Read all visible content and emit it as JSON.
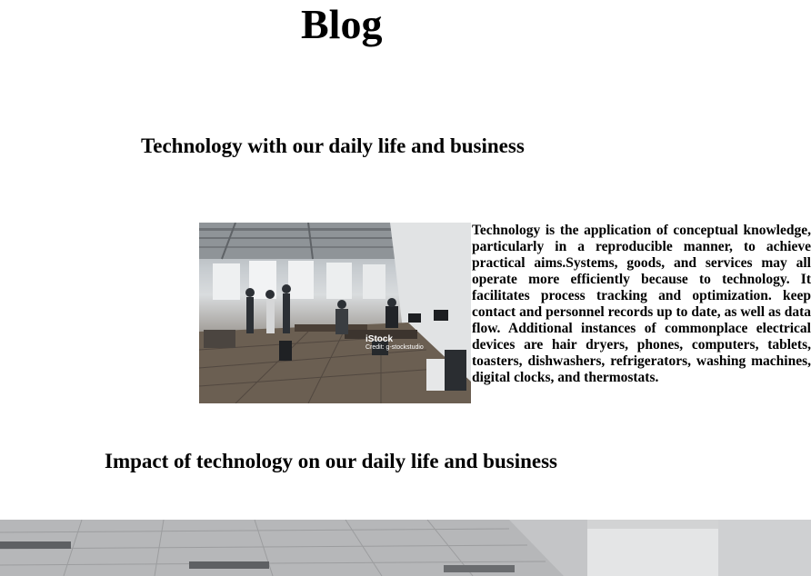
{
  "page": {
    "title": "Blog"
  },
  "sections": [
    {
      "heading": "Technology with our daily life and business",
      "image": {
        "alt": "office photo",
        "watermark_brand": "iStock",
        "watermark_credit": "Credit: g-stockstudio"
      },
      "body": "Technology is the application of conceptual knowledge, particularly in a reproducible manner, to achieve practical aims.Systems, goods, and services may all operate more efficiently because to technology. It facilitates process tracking and optimization. keep contact and personnel records up to date, as well as data flow. Additional instances of commonplace electrical devices are hair dryers, phones, computers, tablets, toasters, dishwashers, refrigerators, washing machines, digital clocks, and thermostats."
    },
    {
      "heading": "Impact of technology on our daily life and business"
    }
  ]
}
